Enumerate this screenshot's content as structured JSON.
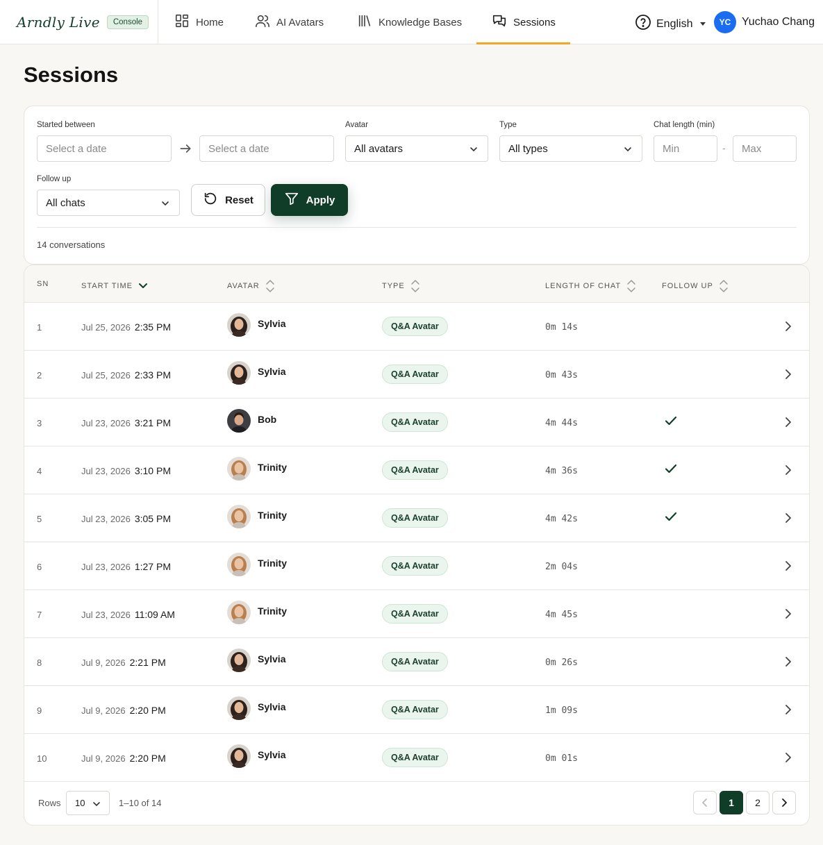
{
  "brand": {
    "logo_text": "Arndly Live",
    "badge": "Console"
  },
  "nav": {
    "items": [
      {
        "label": "Home",
        "icon": "grid-icon"
      },
      {
        "label": "AI Avatars",
        "icon": "users-icon"
      },
      {
        "label": "Knowledge Bases",
        "icon": "library-icon"
      },
      {
        "label": "Sessions",
        "icon": "chat-icon",
        "active": true
      }
    ],
    "accent_color": "#f2a623"
  },
  "header": {
    "language": "English",
    "user_initials": "YC",
    "user_name": "Yuchao Chang"
  },
  "page": {
    "title": "Sessions"
  },
  "filters": {
    "started_between_label": "Started between",
    "start_placeholder": "Select a date",
    "end_placeholder": "Select a date",
    "avatar_label": "Avatar",
    "avatar_value": "All avatars",
    "type_label": "Type",
    "type_value": "All types",
    "chat_length_label": "Chat length (min)",
    "min_placeholder": "Min",
    "max_placeholder": "Max",
    "follow_up_label": "Follow up",
    "follow_up_value": "All chats",
    "reset_label": "Reset",
    "apply_label": "Apply",
    "count_text": "14 conversations"
  },
  "table": {
    "columns": {
      "sn": "SN",
      "start_time": "START TIME",
      "avatar": "AVATAR",
      "type": "TYPE",
      "length": "LENGTH OF CHAT",
      "follow_up": "FOLLOW UP"
    },
    "rows": [
      {
        "sn": "1",
        "date": "Jul 25, 2026",
        "time": "2:35 PM",
        "avatar": "Sylvia",
        "type": "Q&A Avatar",
        "length": "0m 14s",
        "follow_up": false
      },
      {
        "sn": "2",
        "date": "Jul 25, 2026",
        "time": "2:33 PM",
        "avatar": "Sylvia",
        "type": "Q&A Avatar",
        "length": "0m 43s",
        "follow_up": false
      },
      {
        "sn": "3",
        "date": "Jul 23, 2026",
        "time": "3:21 PM",
        "avatar": "Bob",
        "type": "Q&A Avatar",
        "length": "4m 44s",
        "follow_up": true
      },
      {
        "sn": "4",
        "date": "Jul 23, 2026",
        "time": "3:10 PM",
        "avatar": "Trinity",
        "type": "Q&A Avatar",
        "length": "4m 36s",
        "follow_up": true
      },
      {
        "sn": "5",
        "date": "Jul 23, 2026",
        "time": "3:05 PM",
        "avatar": "Trinity",
        "type": "Q&A Avatar",
        "length": "4m 42s",
        "follow_up": true
      },
      {
        "sn": "6",
        "date": "Jul 23, 2026",
        "time": "1:27 PM",
        "avatar": "Trinity",
        "type": "Q&A Avatar",
        "length": "2m 04s",
        "follow_up": false
      },
      {
        "sn": "7",
        "date": "Jul 23, 2026",
        "time": "11:09 AM",
        "avatar": "Trinity",
        "type": "Q&A Avatar",
        "length": "4m 45s",
        "follow_up": false
      },
      {
        "sn": "8",
        "date": "Jul 9, 2026",
        "time": "2:21 PM",
        "avatar": "Sylvia",
        "type": "Q&A Avatar",
        "length": "0m 26s",
        "follow_up": false
      },
      {
        "sn": "9",
        "date": "Jul 9, 2026",
        "time": "2:20 PM",
        "avatar": "Sylvia",
        "type": "Q&A Avatar",
        "length": "1m 09s",
        "follow_up": false
      },
      {
        "sn": "10",
        "date": "Jul 9, 2026",
        "time": "2:20 PM",
        "avatar": "Sylvia",
        "type": "Q&A Avatar",
        "length": "0m 01s",
        "follow_up": false
      }
    ]
  },
  "pagination": {
    "rows_label": "Rows",
    "rows_value": "10",
    "range_text": "1–10 of 14",
    "pages": [
      "1",
      "2"
    ],
    "current_page": "1"
  },
  "colors": {
    "primary": "#0f3d28",
    "accent": "#f2a623",
    "badge_bg": "#eaf5ed",
    "user_avatar": "#1a6cf0"
  }
}
